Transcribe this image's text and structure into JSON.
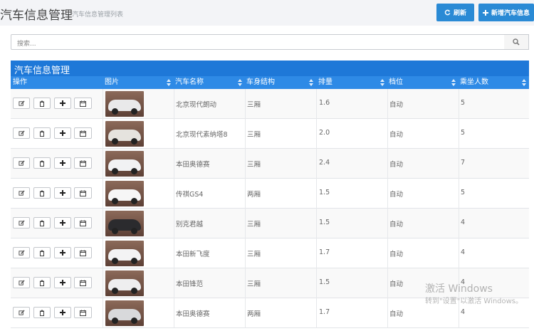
{
  "header": {
    "title": "汽车信息管理",
    "subtitle": "汽车信息管理列表",
    "refresh_label": "刷新",
    "add_label": "新增汽车信息"
  },
  "search": {
    "placeholder": "搜索..."
  },
  "table": {
    "title": "汽车信息管理",
    "columns": [
      "操作",
      "图片",
      "汽车名称",
      "车身结构",
      "排量",
      "档位",
      "乘坐人数"
    ],
    "rows": [
      {
        "name": "北京现代朗动",
        "body": "三厢",
        "displacement": "1.6",
        "gear": "自动",
        "seats": "5",
        "car_color": "#e9e9ea"
      },
      {
        "name": "北京现代素纳塔8",
        "body": "三厢",
        "displacement": "2.0",
        "gear": "自动",
        "seats": "5",
        "car_color": "#e5e3de"
      },
      {
        "name": "本田奥德赛",
        "body": "三厢",
        "displacement": "2.4",
        "gear": "自动",
        "seats": "7",
        "car_color": "#f1f2f3"
      },
      {
        "name": "传祺GS4",
        "body": "两厢",
        "displacement": "1.5",
        "gear": "自动",
        "seats": "5",
        "car_color": "#f6f6f6"
      },
      {
        "name": "别克君越",
        "body": "三厢",
        "displacement": "1.5",
        "gear": "自动",
        "seats": "4",
        "car_color": "#2b2b2e"
      },
      {
        "name": "本田新飞度",
        "body": "三厢",
        "displacement": "1.7",
        "gear": "自动",
        "seats": "4",
        "car_color": "#f3f3f4"
      },
      {
        "name": "本田锋范",
        "body": "三厢",
        "displacement": "1.5",
        "gear": "自动",
        "seats": "4",
        "car_color": "#eeeeef"
      },
      {
        "name": "本田奥德赛",
        "body": "两厢",
        "displacement": "1.7",
        "gear": "自动",
        "seats": "4",
        "car_color": "#d8d9db"
      }
    ]
  },
  "icons": {
    "refresh": "refresh-icon",
    "add": "plus-icon",
    "search": "search-icon",
    "edit": "edit-icon",
    "delete": "trash-icon",
    "plus": "plus-icon",
    "calendar": "calendar-icon"
  },
  "watermark": {
    "line1": "激活 Windows",
    "line2": "转到\"设置\"以激活 Windows。"
  },
  "colors": {
    "primary": "#2a8ad5",
    "table_header": "#1e78d8",
    "column_header": "#2e8ae6"
  }
}
